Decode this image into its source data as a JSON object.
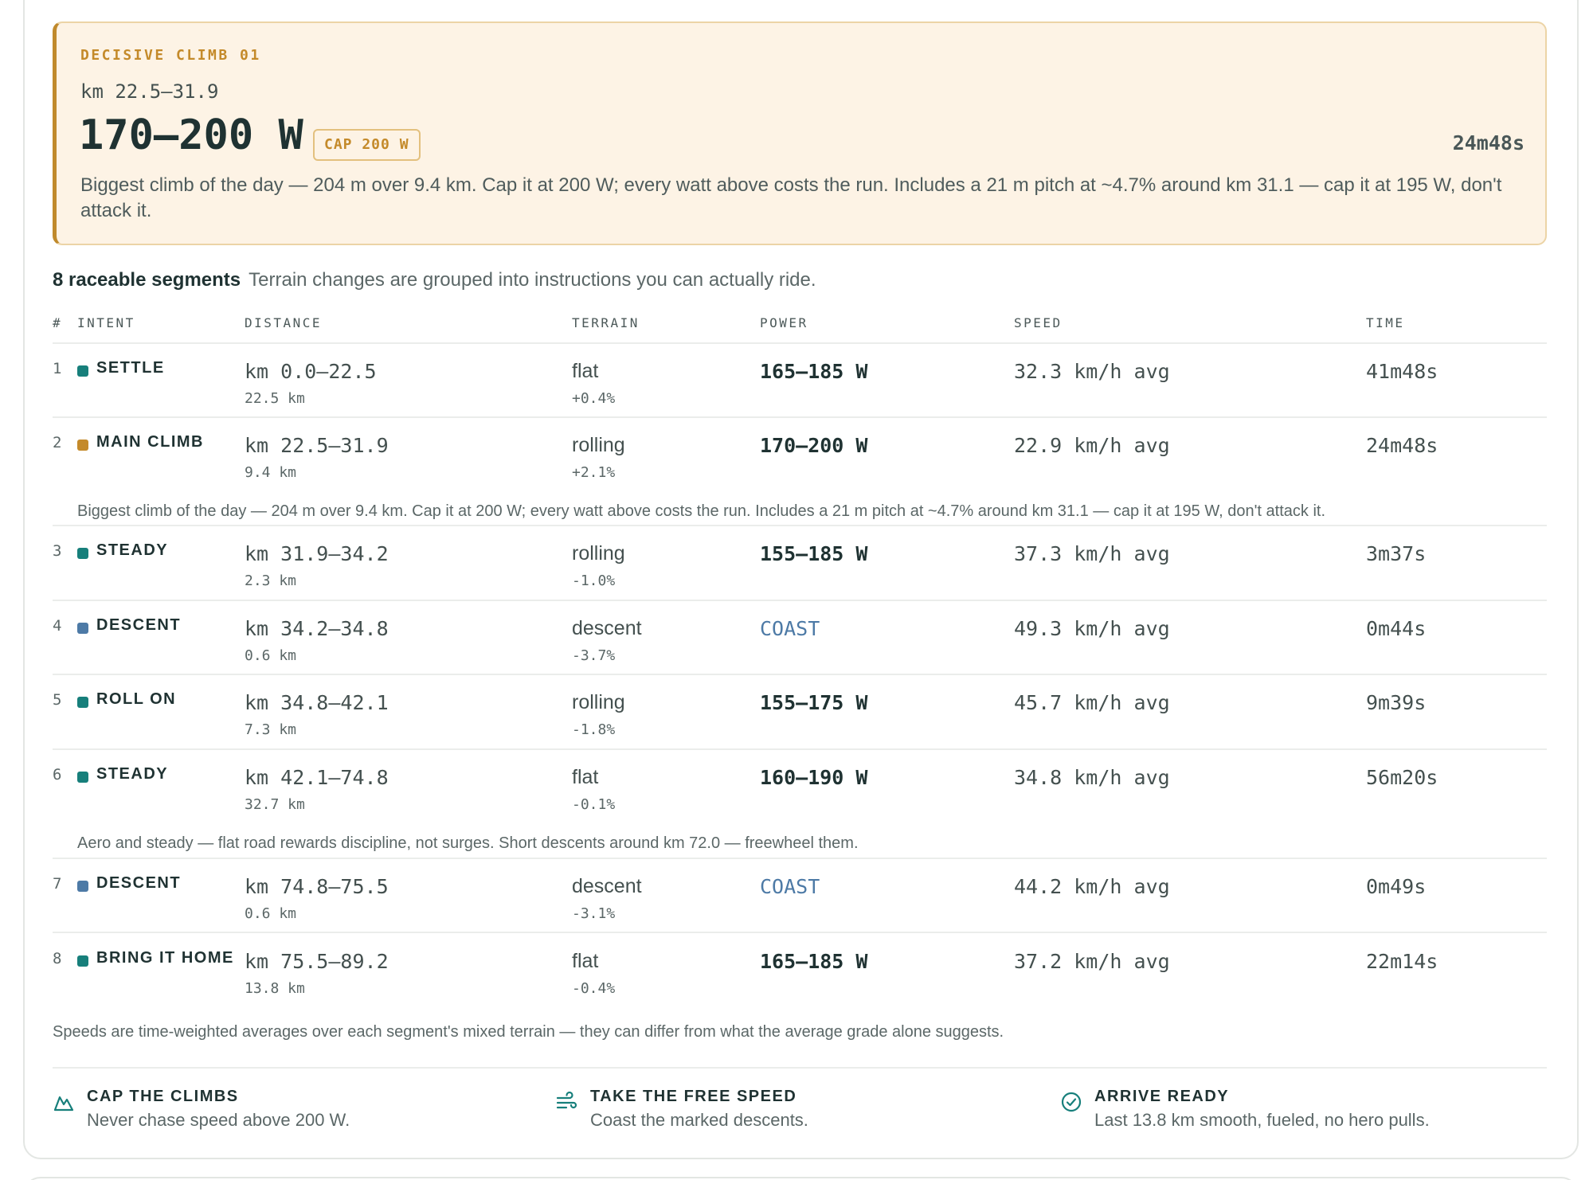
{
  "hero": {
    "eyebrow": "DECISIVE CLIMB 01",
    "range": "km 22.5–31.9",
    "power": "170–200 W",
    "cap": "CAP 200 W",
    "time": "24m48s",
    "description": "Biggest climb of the day — 204 m over 9.4 km. Cap it at 200 W; every watt above costs the run. Includes a 21 m pitch at ~4.7% around km 31.1 — cap it at 195 W, don't attack it."
  },
  "segments": {
    "count_label": "8 raceable segments",
    "subtitle": "Terrain changes are grouped into instructions you can actually ride."
  },
  "table": {
    "columns": [
      "#",
      "INTENT",
      "DISTANCE",
      "TERRAIN",
      "POWER",
      "SPEED",
      "TIME"
    ],
    "rows": [
      {
        "num": "1",
        "intent": "SETTLE",
        "color": "#177f7b",
        "range": "km 0.0–22.5",
        "length": "22.5 km",
        "terrain": "flat",
        "grade": "+0.4%",
        "power": "165–185 W",
        "coast": false,
        "speed": "32.3 km/h avg",
        "time": "41m48s",
        "note": ""
      },
      {
        "num": "2",
        "intent": "MAIN CLIMB",
        "color": "#c48a2a",
        "range": "km 22.5–31.9",
        "length": "9.4 km",
        "terrain": "rolling",
        "grade": "+2.1%",
        "power": "170–200 W",
        "coast": false,
        "speed": "22.9 km/h avg",
        "time": "24m48s",
        "note": "Biggest climb of the day — 204 m over 9.4 km. Cap it at 200 W; every watt above costs the run. Includes a 21 m pitch at ~4.7% around km 31.1 — cap it at 195 W, don't attack it."
      },
      {
        "num": "3",
        "intent": "STEADY",
        "color": "#177f7b",
        "range": "km 31.9–34.2",
        "length": "2.3 km",
        "terrain": "rolling",
        "grade": "-1.0%",
        "power": "155–185 W",
        "coast": false,
        "speed": "37.3 km/h avg",
        "time": "3m37s",
        "note": ""
      },
      {
        "num": "4",
        "intent": "DESCENT",
        "color": "#4d7aa6",
        "range": "km 34.2–34.8",
        "length": "0.6 km",
        "terrain": "descent",
        "grade": "-3.7%",
        "power": "COAST",
        "coast": true,
        "speed": "49.3 km/h avg",
        "time": "0m44s",
        "note": ""
      },
      {
        "num": "5",
        "intent": "ROLL ON",
        "color": "#177f7b",
        "range": "km 34.8–42.1",
        "length": "7.3 km",
        "terrain": "rolling",
        "grade": "-1.8%",
        "power": "155–175 W",
        "coast": false,
        "speed": "45.7 km/h avg",
        "time": "9m39s",
        "note": ""
      },
      {
        "num": "6",
        "intent": "STEADY",
        "color": "#177f7b",
        "range": "km 42.1–74.8",
        "length": "32.7 km",
        "terrain": "flat",
        "grade": "-0.1%",
        "power": "160–190 W",
        "coast": false,
        "speed": "34.8 km/h avg",
        "time": "56m20s",
        "note": "Aero and steady — flat road rewards discipline, not surges. Short descents around km 72.0 — freewheel them."
      },
      {
        "num": "7",
        "intent": "DESCENT",
        "color": "#4d7aa6",
        "range": "km 74.8–75.5",
        "length": "0.6 km",
        "terrain": "descent",
        "grade": "-3.1%",
        "power": "COAST",
        "coast": true,
        "speed": "44.2 km/h avg",
        "time": "0m49s",
        "note": ""
      },
      {
        "num": "8",
        "intent": "BRING IT HOME",
        "color": "#177f7b",
        "range": "km 75.5–89.2",
        "length": "13.8 km",
        "terrain": "flat",
        "grade": "-0.4%",
        "power": "165–185 W",
        "coast": false,
        "speed": "37.2 km/h avg",
        "time": "22m14s",
        "note": ""
      }
    ]
  },
  "footnote": "Speeds are time-weighted averages over each segment's mixed terrain — they can differ from what the average grade alone suggests.",
  "tips": [
    {
      "icon": "mountain-icon",
      "title": "CAP THE CLIMBS",
      "text": "Never chase speed above 200 W."
    },
    {
      "icon": "wind-icon",
      "title": "TAKE THE FREE SPEED",
      "text": "Coast the marked descents."
    },
    {
      "icon": "check-circle-icon",
      "title": "ARRIVE READY",
      "text": "Last 13.8 km smooth, fueled, no hero pulls."
    }
  ],
  "colors": {
    "accent": "#c48a2a",
    "teal": "#177f7b",
    "blue": "#4d7aa6"
  }
}
